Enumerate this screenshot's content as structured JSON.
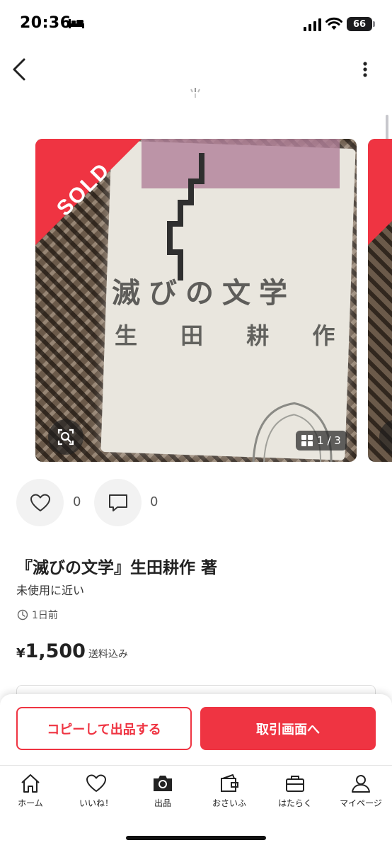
{
  "status_bar": {
    "time": "20:36",
    "battery": "66"
  },
  "carousel": {
    "sold_label": "SOLD",
    "counter": "1 / 3"
  },
  "photo_text": {
    "title": "滅びの文学",
    "author": "生 田 耕 作"
  },
  "actions": {
    "like_count": "0",
    "comment_count": "0"
  },
  "item": {
    "title": "『滅びの文学』生田耕作 著",
    "condition": "未使用に近い",
    "posted": "1日前",
    "price_currency": "¥",
    "price": "1,500",
    "shipping_note": "送料込み"
  },
  "buttons": {
    "copy_label": "コピーして出品する",
    "transaction_label": "取引画面へ"
  },
  "tabs": [
    {
      "label": "ホーム",
      "icon": "home-icon"
    },
    {
      "label": "いいね！",
      "icon": "heart-icon"
    },
    {
      "label": "出品",
      "icon": "camera-icon"
    },
    {
      "label": "おさいふ",
      "icon": "wallet-icon"
    },
    {
      "label": "はたらく",
      "icon": "briefcase-icon"
    },
    {
      "label": "マイページ",
      "icon": "person-icon"
    }
  ],
  "colors": {
    "accent": "#ef3442"
  }
}
